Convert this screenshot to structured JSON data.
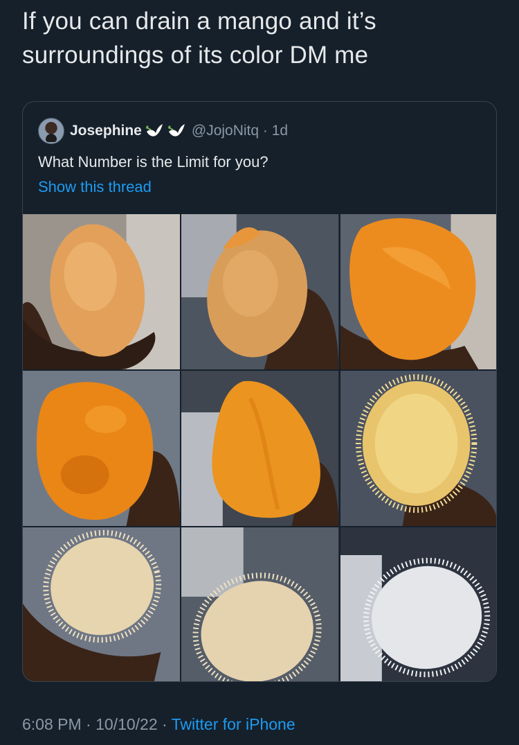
{
  "tweet": {
    "text_line1": "If you can drain a mango and it’s",
    "text_line2": "surroundings of its color DM me"
  },
  "quoted": {
    "name": "Josephine",
    "handle": "@JojoNitq · 1d",
    "text": "What Number is the Limit for you?",
    "show_thread": "Show this thread",
    "images": [
      "mango-stage-1",
      "mango-stage-2",
      "mango-stage-3",
      "mango-stage-4",
      "mango-stage-5",
      "mango-stage-6",
      "mango-stage-7",
      "mango-stage-8",
      "mango-stage-9"
    ]
  },
  "meta": {
    "time_date": "6:08 PM · 10/10/22 · ",
    "source": "Twitter for iPhone"
  },
  "colors": {
    "background": "#15202b",
    "text": "#e7e9ea",
    "secondary": "#8b98a5",
    "link": "#1d9bf0",
    "border": "#38444d"
  }
}
